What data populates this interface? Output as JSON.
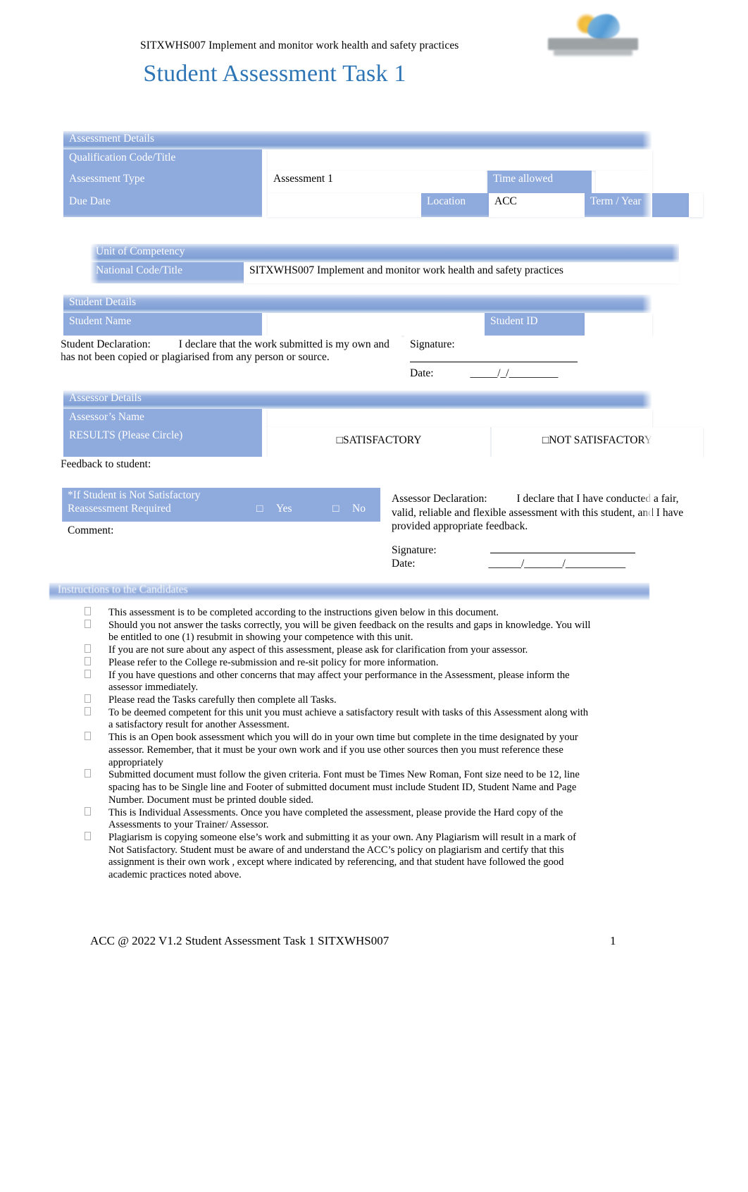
{
  "header": {
    "unit_line": "SITXWHS007 Implement and monitor work health and safety practices",
    "title": "Student Assessment Task 1",
    "logo_name": "acc-college-logo"
  },
  "assessment_details": {
    "section_label": "Assessment Details",
    "qualification_label": "Qualification Code/Title",
    "qualification_value": "",
    "assessment_type_label": "Assessment Type",
    "assessment_type_value": "Assessment 1",
    "time_allowed_label": "Time allowed",
    "time_allowed_value": "",
    "due_date_label": "Due Date",
    "due_date_value": "",
    "location_label": "Location",
    "location_value": "ACC",
    "term_year_label": "Term / Year",
    "term_year_value": ""
  },
  "unit_of_competency": {
    "section_label": "Unit of Competency",
    "national_code_label": "National Code/Title",
    "national_code_value": "SITXWHS007 Implement and monitor work health and safety practices"
  },
  "student_details": {
    "section_label": "Student Details",
    "student_name_label": "Student Name",
    "student_name_value": "",
    "student_id_label": "Student ID",
    "student_id_value": "",
    "declaration_label": "Student Declaration:",
    "declaration_text": "I declare that the work submitted is my own and has not been copied or plagiarised from any person or source.",
    "signature_label": "Signature:",
    "date_label": "Date:",
    "date_placeholder": "_____/_/_________"
  },
  "assessor_details": {
    "section_label": "Assessor Details",
    "assessor_name_label": "Assessor’s Name",
    "assessor_name_value": "",
    "results_label": "RESULTS (Please Circle)",
    "result_satisfactory": "SATISFACTORY",
    "result_not_satisfactory": "NOT SATISFACTORY",
    "checkbox_glyph": "□",
    "feedback_label": "Feedback to student:",
    "feedback_value": ""
  },
  "reassessment": {
    "heading": "*If Student is Not Satisfactory",
    "required_label": "Reassessment Required",
    "yes_label": "Yes",
    "no_label": "No",
    "checkbox_glyph": "□",
    "comment_label": "Comment:",
    "comment_value": ""
  },
  "assessor_declaration": {
    "label": "Assessor Declaration:",
    "text": "I declare that I have conducted a fair, valid, reliable and flexible assessment with this student, and I have provided appropriate feedback.",
    "signature_label": "Signature:",
    "date_label": "Date:",
    "date_placeholder": "______/_______/___________"
  },
  "instructions": {
    "heading": "Instructions to the Candidates",
    "items": [
      "This assessment is to be completed according to the instructions given below in this document.",
      "Should you not answer the tasks correctly, you will be given feedback on the results and gaps in knowledge. You will be entitled to one (1) resubmit in showing your competence with this unit.",
      "If you are not sure about any aspect of this assessment, please ask for clarification from your assessor.",
      "Please refer to the College re-submission and re-sit policy for more information.",
      "If you have questions and other concerns that may affect your performance in the Assessment, please inform the assessor immediately.",
      "Please read the Tasks carefully then complete all Tasks.",
      "To be deemed competent for this unit you must achieve a satisfactory result with tasks of this Assessment along with a satisfactory result for another Assessment.",
      "This is an Open book assessment which you will do in your own time but complete in the time designated by your assessor. Remember, that it must be your own work and if you use other sources then you must reference these appropriately",
      "Submitted document must follow the given criteria. Font must be Times New Roman, Font size need to be 12, line spacing has to be Single line and Footer of submitted document must include Student ID, Student Name and Page Number. Document must be printed double sided.",
      "This is Individual Assessments. Once you have completed the assessment, please provide the Hard copy of the Assessments to your Trainer/ Assessor.",
      "Plagiarism is copying someone else’s work and submitting it as your own. Any Plagiarism will result in a mark of Not Satisfactory. Student must be aware of and understand the ACC’s policy on plagiarism and certify that this assignment is their own work   , except where indicated by referencing, and that student have followed the good academic practices noted above."
    ]
  },
  "footer": {
    "left": "ACC @ 2022 V1.2 Student Assessment Task 1 SITXWHS007",
    "page_number": "1"
  },
  "colors": {
    "accent_blue": "#8faadc",
    "title_blue": "#2e75b6",
    "light_blue": "#b4c7e7"
  }
}
